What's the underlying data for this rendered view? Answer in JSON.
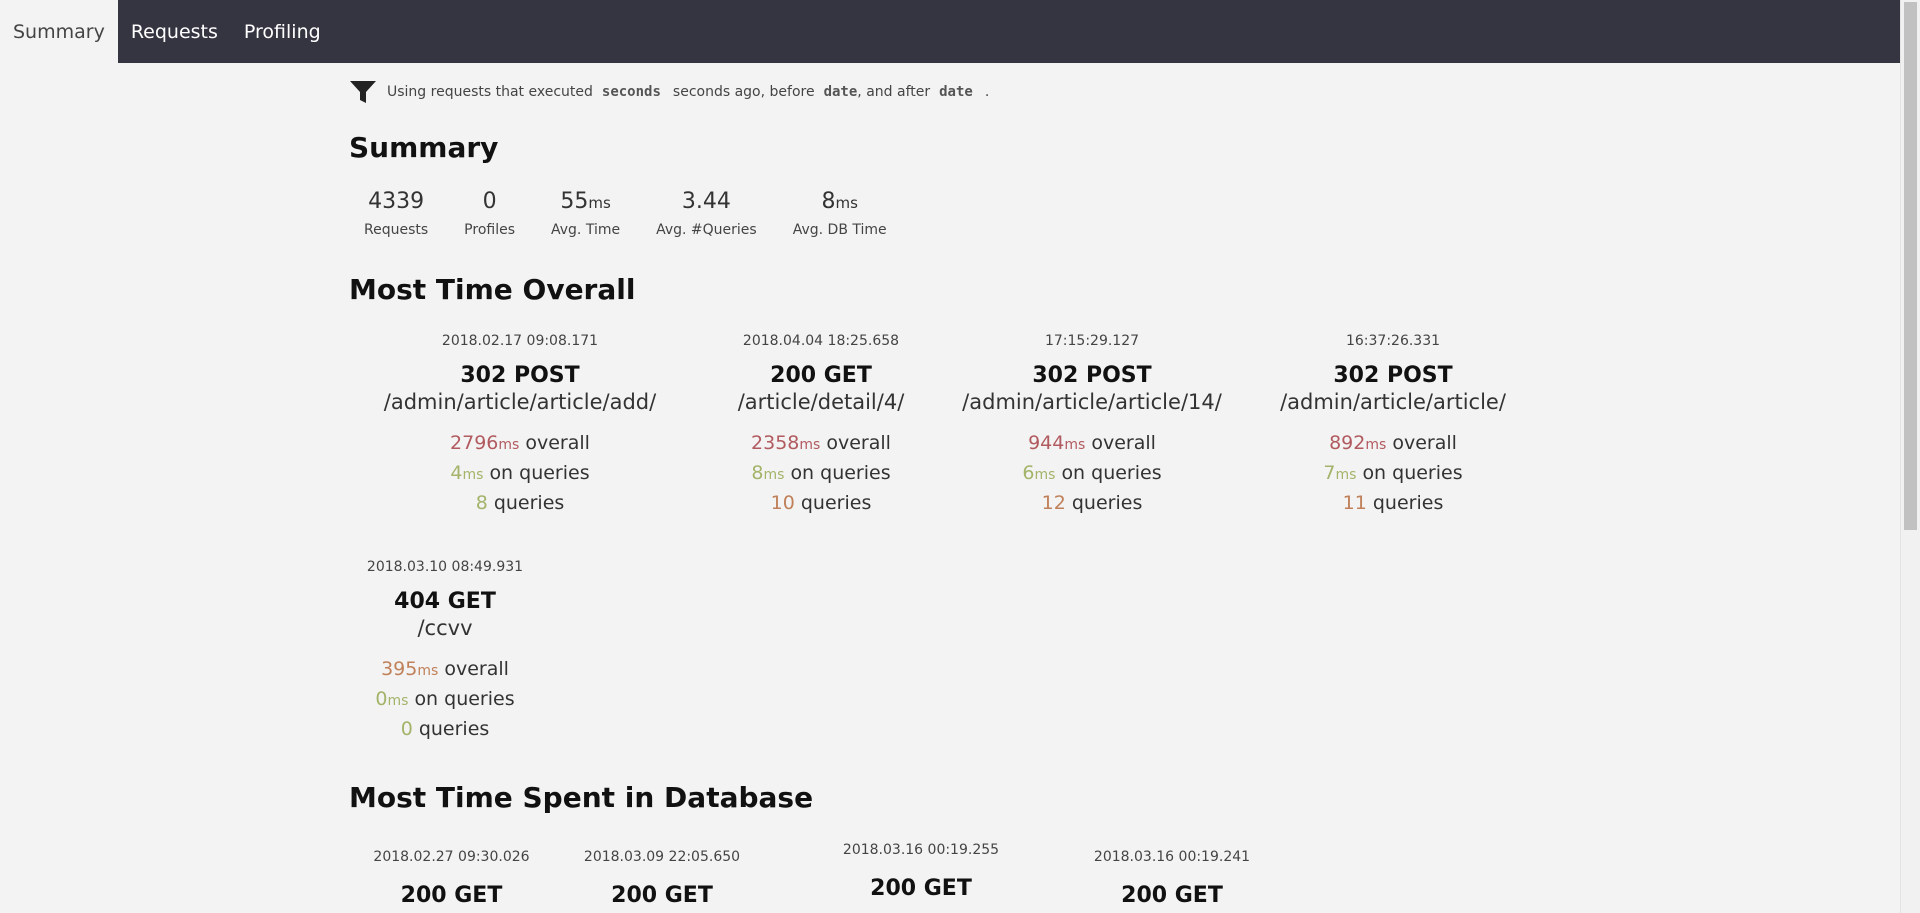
{
  "nav": {
    "tabs": [
      {
        "label": "Summary",
        "active": true
      },
      {
        "label": "Requests",
        "active": false
      },
      {
        "label": "Profiling",
        "active": false
      }
    ]
  },
  "filter": {
    "icon": "filter-icon",
    "prefix": "Using requests that executed",
    "seconds_token": "seconds",
    "middle": "seconds ago, before",
    "date_token_1": "date",
    "after": ", and after",
    "date_token_2": "date",
    "end": "."
  },
  "summary": {
    "title": "Summary",
    "stats": [
      {
        "value": "4339",
        "unit": "",
        "label": "Requests"
      },
      {
        "value": "0",
        "unit": "",
        "label": "Profiles"
      },
      {
        "value": "55",
        "unit": "ms",
        "label": "Avg. Time"
      },
      {
        "value": "3.44",
        "unit": "",
        "label": "Avg. #Queries"
      },
      {
        "value": "8",
        "unit": "ms",
        "label": "Avg. DB Time"
      }
    ]
  },
  "most_time_overall": {
    "title": "Most Time Overall",
    "cards": [
      {
        "timestamp": "2018.02.17 09:08.171",
        "status_method": "302 POST",
        "path": "/admin/article/article/add/",
        "overall": "2796",
        "queries_time": "4",
        "queries": "8"
      },
      {
        "timestamp": "2018.04.04 18:25.658",
        "status_method": "200 GET",
        "path": "/article/detail/4/",
        "overall": "2358",
        "queries_time": "8",
        "queries": "10"
      },
      {
        "timestamp": "17:15:29.127",
        "status_method": "302 POST",
        "path": "/admin/article/article/14/",
        "overall": "944",
        "queries_time": "6",
        "queries": "12"
      },
      {
        "timestamp": "16:37:26.331",
        "status_method": "302 POST",
        "path": "/admin/article/article/",
        "overall": "892",
        "queries_time": "7",
        "queries": "11"
      },
      {
        "timestamp": "2018.03.10 08:49.931",
        "status_method": "404 GET",
        "path": "/ccvv",
        "overall": "395",
        "queries_time": "0",
        "queries": "0"
      }
    ],
    "unit": "ms",
    "overall_label": "overall",
    "on_queries_label": "on queries",
    "queries_label": "queries"
  },
  "most_time_db": {
    "title": "Most Time Spent in Database",
    "cards": [
      {
        "timestamp": "2018.02.27 09:30.026",
        "status_method": "200 GET"
      },
      {
        "timestamp": "2018.03.09 22:05.650",
        "status_method": "200 GET"
      },
      {
        "timestamp": "2018.03.16 00:19.255",
        "status_method": "200 GET"
      },
      {
        "timestamp": "2018.03.16 00:19.241",
        "status_method": "200 GET"
      }
    ]
  },
  "colors": {
    "nav_bg": "#353542",
    "page_bg": "#f3f3f3",
    "red": "#b15a5f",
    "green": "#a3b46a",
    "orange": "#c08059"
  }
}
